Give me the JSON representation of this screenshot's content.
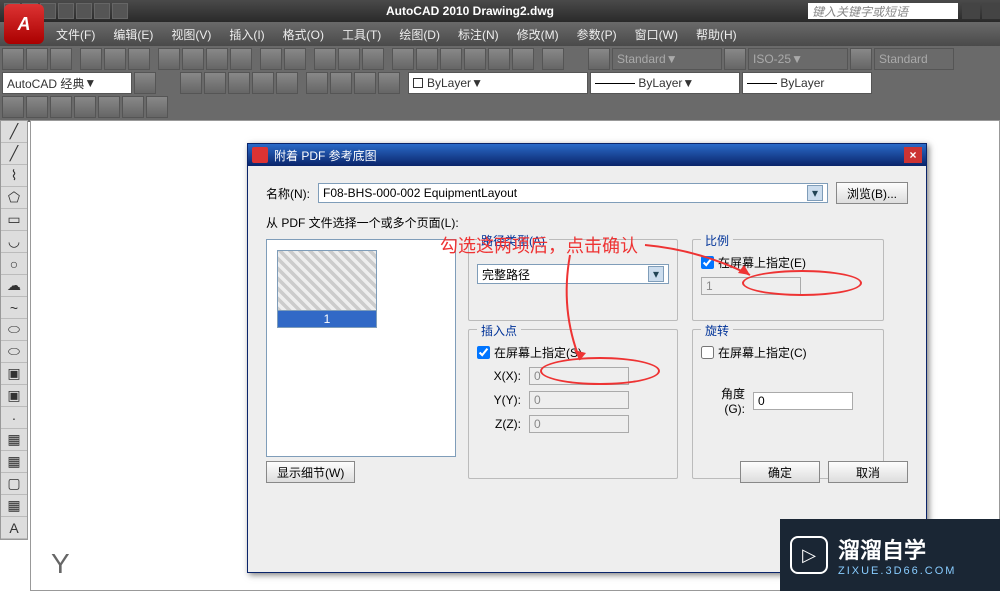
{
  "title": "AutoCAD 2010  Drawing2.dwg",
  "search_placeholder": "键入关键字或短语",
  "appbtn": "A",
  "menus": [
    {
      "label": "文件(F)"
    },
    {
      "label": "编辑(E)"
    },
    {
      "label": "视图(V)"
    },
    {
      "label": "插入(I)"
    },
    {
      "label": "格式(O)"
    },
    {
      "label": "工具(T)"
    },
    {
      "label": "绘图(D)"
    },
    {
      "label": "标注(N)"
    },
    {
      "label": "修改(M)"
    },
    {
      "label": "参数(P)"
    },
    {
      "label": "窗口(W)"
    },
    {
      "label": "帮助(H)"
    }
  ],
  "workspace": "AutoCAD 经典",
  "style1": "Standard",
  "style2": "ISO-25",
  "style3": "Standard",
  "layer_label": "ByLayer",
  "dialog": {
    "title": "附着 PDF 参考底图",
    "name_label": "名称(N):",
    "name_value": "F08-BHS-000-002 EquipmentLayout",
    "browse": "浏览(B)...",
    "prompt": "从 PDF 文件选择一个或多个页面(L):",
    "thumb_label": "1",
    "path_group": "路径类型(A)",
    "path_value": "完整路径",
    "insert_group": "插入点",
    "onscreen_s": "在屏幕上指定(S)",
    "x_label": "X(X):",
    "x_val": "0",
    "y_label": "Y(Y):",
    "y_val": "0",
    "z_label": "Z(Z):",
    "z_val": "0",
    "scale_group": "比例",
    "onscreen_e": "在屏幕上指定(E)",
    "scale_val": "1",
    "rot_group": "旋转",
    "onscreen_c": "在屏幕上指定(C)",
    "angle_label": "角度(G):",
    "angle_val": "0",
    "details": "显示细节(W)",
    "ok": "确定",
    "cancel": "取消"
  },
  "annotation": "勾选这两项后，点击确认",
  "watermark": {
    "main": "溜溜自学",
    "sub": "ZIXUE.3D66.COM"
  },
  "cursor_text": "Y"
}
